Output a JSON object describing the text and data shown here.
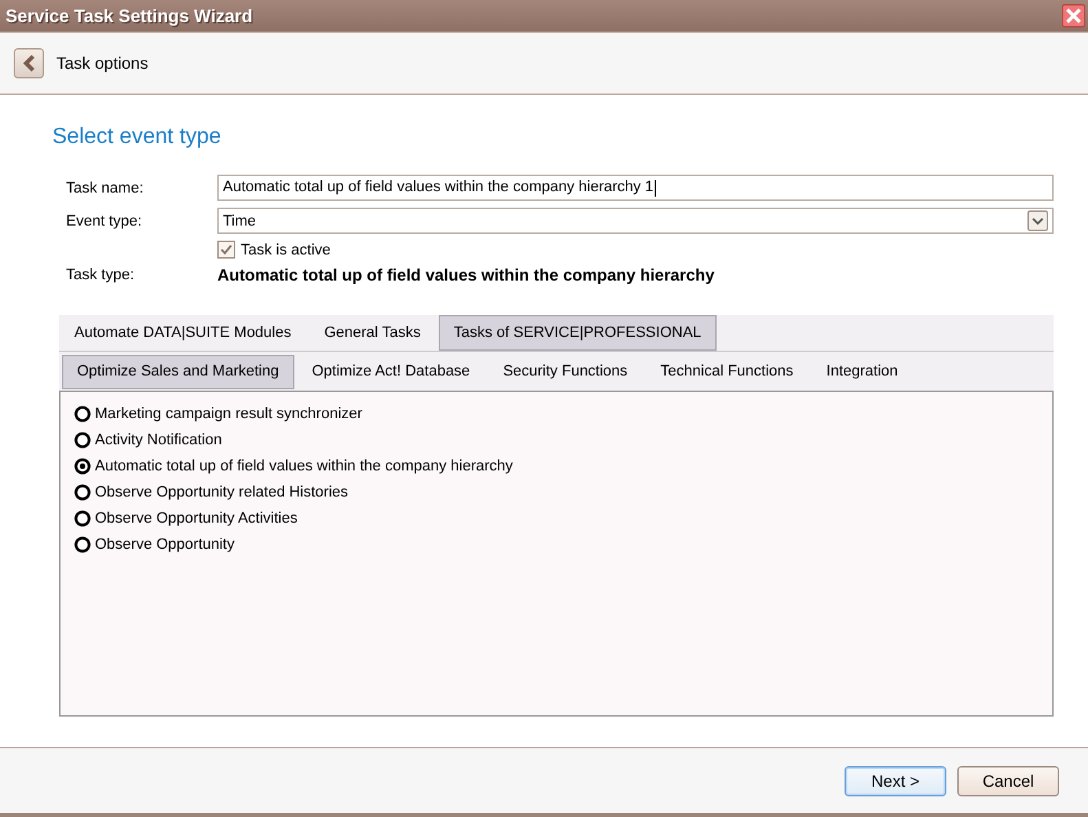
{
  "window": {
    "title": "Service Task Settings Wizard"
  },
  "header": {
    "title": "Task options"
  },
  "section_title": "Select event type",
  "form": {
    "task_name_label": "Task name:",
    "task_name": "Automatic total up of field values within the company hierarchy 1",
    "event_type_label": "Event type:",
    "event_type": "Time",
    "active_label": "Task is active",
    "active_checked": true,
    "task_type_label": "Task type:",
    "task_type": "Automatic total up of field values within the company hierarchy"
  },
  "tabs": [
    {
      "label": "Automate DATA|SUITE Modules",
      "selected": false
    },
    {
      "label": "General Tasks",
      "selected": false
    },
    {
      "label": "Tasks of SERVICE|PROFESSIONAL",
      "selected": true
    }
  ],
  "subtabs": [
    {
      "label": "Optimize Sales and Marketing",
      "selected": true
    },
    {
      "label": "Optimize Act! Database",
      "selected": false
    },
    {
      "label": "Security Functions",
      "selected": false
    },
    {
      "label": "Technical Functions",
      "selected": false
    },
    {
      "label": "Integration",
      "selected": false
    }
  ],
  "options": [
    {
      "label": "Marketing campaign result synchronizer",
      "selected": false
    },
    {
      "label": "Activity Notification",
      "selected": false
    },
    {
      "label": "Automatic total up of field values within the company hierarchy",
      "selected": true
    },
    {
      "label": "Observe Opportunity related Histories",
      "selected": false
    },
    {
      "label": "Observe Opportunity Activities",
      "selected": false
    },
    {
      "label": "Observe Opportunity",
      "selected": false
    }
  ],
  "buttons": [
    {
      "label": "Next >",
      "kind": "default"
    },
    {
      "label": "Cancel",
      "kind": "normal"
    }
  ]
}
